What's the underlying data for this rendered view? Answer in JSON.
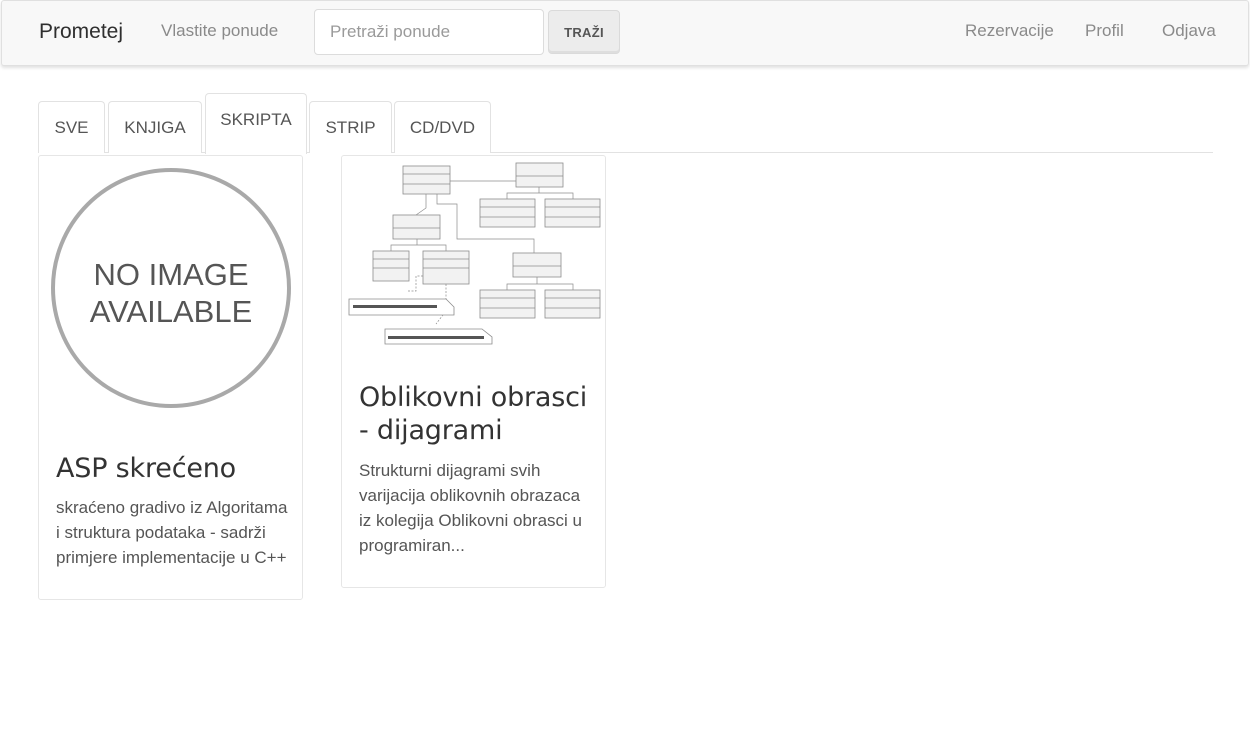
{
  "navbar": {
    "brand": "Prometej",
    "own_offers": "Vlastite ponude",
    "search_placeholder": "Pretraži ponude",
    "search_button": "TRAŽI",
    "reservations": "Rezervacije",
    "profile": "Profil",
    "logout": "Odjava"
  },
  "tabs": [
    {
      "label": "SVE",
      "active": false
    },
    {
      "label": "KNJIGA",
      "active": false
    },
    {
      "label": "SKRIPTA",
      "active": true
    },
    {
      "label": "STRIP",
      "active": false
    },
    {
      "label": "CD/DVD",
      "active": false
    }
  ],
  "cards": [
    {
      "image_text_line1": "NO IMAGE",
      "image_text_line2": "AVAILABLE",
      "title": "ASP skrećeno",
      "description": "skraćeno gradivo iz Algoritama i struktura podataka - sadrži primjere implementacije u C++"
    },
    {
      "image_icon": "uml-class-diagram",
      "title": "Oblikovni obrasci - dijagrami",
      "description": "Strukturni dijagrami svih varijacija oblikovnih obrazaca iz kolegija Oblikovni obrasci u programiran..."
    }
  ]
}
